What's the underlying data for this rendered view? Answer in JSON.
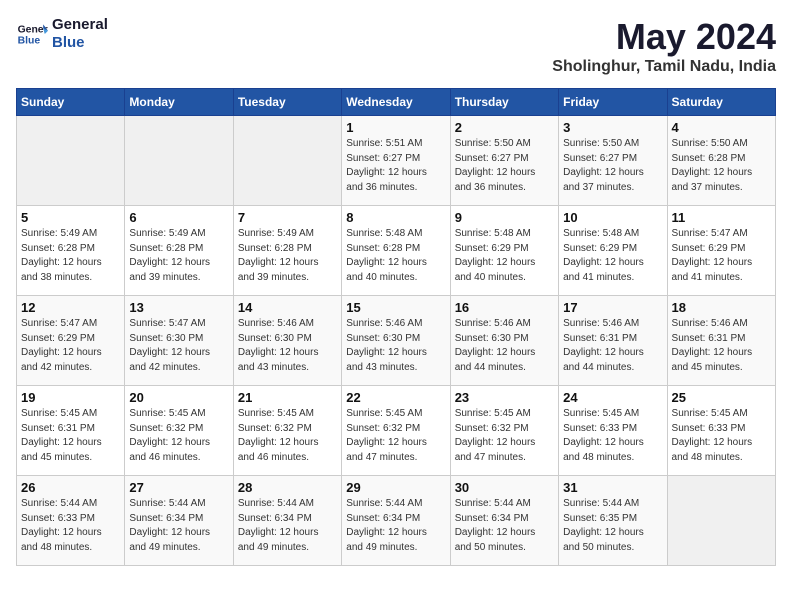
{
  "header": {
    "logo_line1": "General",
    "logo_line2": "Blue",
    "month_year": "May 2024",
    "location": "Sholinghur, Tamil Nadu, India"
  },
  "days_of_week": [
    "Sunday",
    "Monday",
    "Tuesday",
    "Wednesday",
    "Thursday",
    "Friday",
    "Saturday"
  ],
  "weeks": [
    [
      {
        "day": "",
        "info": ""
      },
      {
        "day": "",
        "info": ""
      },
      {
        "day": "",
        "info": ""
      },
      {
        "day": "1",
        "info": "Sunrise: 5:51 AM\nSunset: 6:27 PM\nDaylight: 12 hours\nand 36 minutes."
      },
      {
        "day": "2",
        "info": "Sunrise: 5:50 AM\nSunset: 6:27 PM\nDaylight: 12 hours\nand 36 minutes."
      },
      {
        "day": "3",
        "info": "Sunrise: 5:50 AM\nSunset: 6:27 PM\nDaylight: 12 hours\nand 37 minutes."
      },
      {
        "day": "4",
        "info": "Sunrise: 5:50 AM\nSunset: 6:28 PM\nDaylight: 12 hours\nand 37 minutes."
      }
    ],
    [
      {
        "day": "5",
        "info": "Sunrise: 5:49 AM\nSunset: 6:28 PM\nDaylight: 12 hours\nand 38 minutes."
      },
      {
        "day": "6",
        "info": "Sunrise: 5:49 AM\nSunset: 6:28 PM\nDaylight: 12 hours\nand 39 minutes."
      },
      {
        "day": "7",
        "info": "Sunrise: 5:49 AM\nSunset: 6:28 PM\nDaylight: 12 hours\nand 39 minutes."
      },
      {
        "day": "8",
        "info": "Sunrise: 5:48 AM\nSunset: 6:28 PM\nDaylight: 12 hours\nand 40 minutes."
      },
      {
        "day": "9",
        "info": "Sunrise: 5:48 AM\nSunset: 6:29 PM\nDaylight: 12 hours\nand 40 minutes."
      },
      {
        "day": "10",
        "info": "Sunrise: 5:48 AM\nSunset: 6:29 PM\nDaylight: 12 hours\nand 41 minutes."
      },
      {
        "day": "11",
        "info": "Sunrise: 5:47 AM\nSunset: 6:29 PM\nDaylight: 12 hours\nand 41 minutes."
      }
    ],
    [
      {
        "day": "12",
        "info": "Sunrise: 5:47 AM\nSunset: 6:29 PM\nDaylight: 12 hours\nand 42 minutes."
      },
      {
        "day": "13",
        "info": "Sunrise: 5:47 AM\nSunset: 6:30 PM\nDaylight: 12 hours\nand 42 minutes."
      },
      {
        "day": "14",
        "info": "Sunrise: 5:46 AM\nSunset: 6:30 PM\nDaylight: 12 hours\nand 43 minutes."
      },
      {
        "day": "15",
        "info": "Sunrise: 5:46 AM\nSunset: 6:30 PM\nDaylight: 12 hours\nand 43 minutes."
      },
      {
        "day": "16",
        "info": "Sunrise: 5:46 AM\nSunset: 6:30 PM\nDaylight: 12 hours\nand 44 minutes."
      },
      {
        "day": "17",
        "info": "Sunrise: 5:46 AM\nSunset: 6:31 PM\nDaylight: 12 hours\nand 44 minutes."
      },
      {
        "day": "18",
        "info": "Sunrise: 5:46 AM\nSunset: 6:31 PM\nDaylight: 12 hours\nand 45 minutes."
      }
    ],
    [
      {
        "day": "19",
        "info": "Sunrise: 5:45 AM\nSunset: 6:31 PM\nDaylight: 12 hours\nand 45 minutes."
      },
      {
        "day": "20",
        "info": "Sunrise: 5:45 AM\nSunset: 6:32 PM\nDaylight: 12 hours\nand 46 minutes."
      },
      {
        "day": "21",
        "info": "Sunrise: 5:45 AM\nSunset: 6:32 PM\nDaylight: 12 hours\nand 46 minutes."
      },
      {
        "day": "22",
        "info": "Sunrise: 5:45 AM\nSunset: 6:32 PM\nDaylight: 12 hours\nand 47 minutes."
      },
      {
        "day": "23",
        "info": "Sunrise: 5:45 AM\nSunset: 6:32 PM\nDaylight: 12 hours\nand 47 minutes."
      },
      {
        "day": "24",
        "info": "Sunrise: 5:45 AM\nSunset: 6:33 PM\nDaylight: 12 hours\nand 48 minutes."
      },
      {
        "day": "25",
        "info": "Sunrise: 5:45 AM\nSunset: 6:33 PM\nDaylight: 12 hours\nand 48 minutes."
      }
    ],
    [
      {
        "day": "26",
        "info": "Sunrise: 5:44 AM\nSunset: 6:33 PM\nDaylight: 12 hours\nand 48 minutes."
      },
      {
        "day": "27",
        "info": "Sunrise: 5:44 AM\nSunset: 6:34 PM\nDaylight: 12 hours\nand 49 minutes."
      },
      {
        "day": "28",
        "info": "Sunrise: 5:44 AM\nSunset: 6:34 PM\nDaylight: 12 hours\nand 49 minutes."
      },
      {
        "day": "29",
        "info": "Sunrise: 5:44 AM\nSunset: 6:34 PM\nDaylight: 12 hours\nand 49 minutes."
      },
      {
        "day": "30",
        "info": "Sunrise: 5:44 AM\nSunset: 6:34 PM\nDaylight: 12 hours\nand 50 minutes."
      },
      {
        "day": "31",
        "info": "Sunrise: 5:44 AM\nSunset: 6:35 PM\nDaylight: 12 hours\nand 50 minutes."
      },
      {
        "day": "",
        "info": ""
      }
    ]
  ]
}
